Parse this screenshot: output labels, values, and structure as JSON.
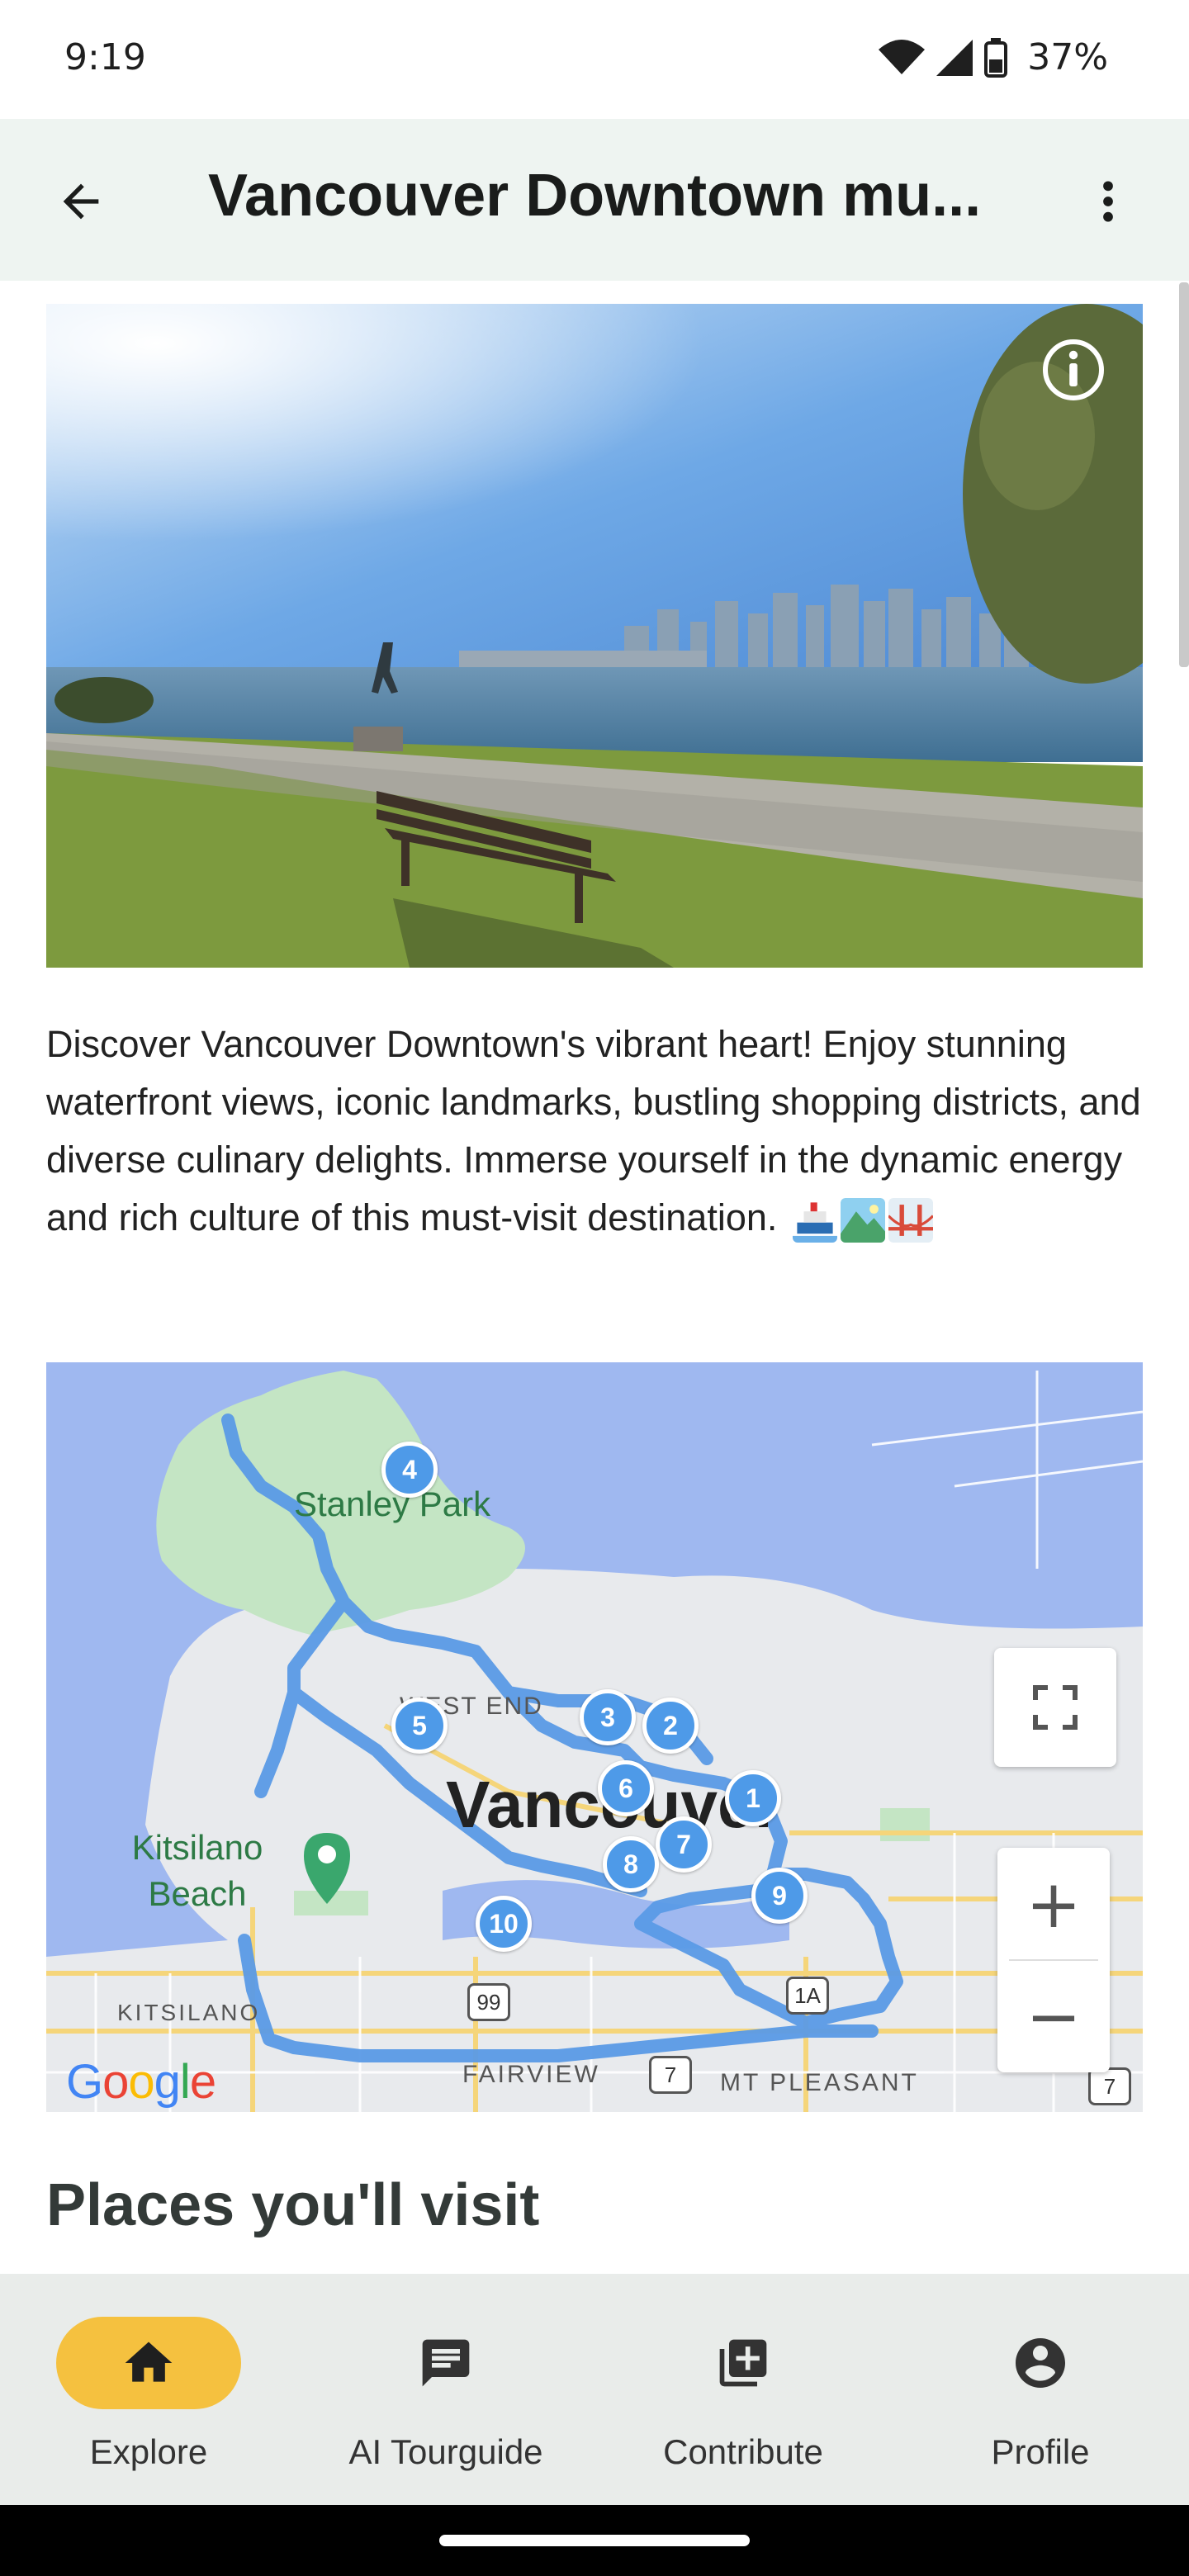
{
  "status_bar": {
    "time": "9:19",
    "battery": "37%"
  },
  "app_bar": {
    "title": "Vancouver Downtown mu..."
  },
  "hero": {
    "info_icon": "info-icon"
  },
  "description": {
    "text": "Discover Vancouver Downtown's vibrant heart! Enjoy stunning waterfront views, iconic landmarks, bustling shopping districts, and diverse culinary delights. Immerse yourself in the dynamic energy and rich culture of this must-visit destination."
  },
  "map": {
    "labels": {
      "stanley_park": "Stanley Park",
      "west_end": "WEST END",
      "vancouver": "Vancouver",
      "kitsilano_beach": "Kitsilano Beach",
      "kitsilano": "KITSILANO",
      "fairview": "FAIRVIEW",
      "mt_pleasant": "MT PLEASANT"
    },
    "road_shields": [
      "99",
      "7",
      "1A",
      "7"
    ],
    "markers": [
      "1",
      "2",
      "3",
      "4",
      "5",
      "6",
      "7",
      "8",
      "9",
      "10"
    ],
    "zoom_in": "+",
    "zoom_out": "−",
    "google_logo": "Google"
  },
  "places_heading": "Places you'll visit",
  "bottom_nav": {
    "items": [
      {
        "label": "Explore",
        "icon": "home-icon",
        "active": true
      },
      {
        "label": "AI Tourguide",
        "icon": "chat-icon",
        "active": false
      },
      {
        "label": "Contribute",
        "icon": "add-box-icon",
        "active": false
      },
      {
        "label": "Profile",
        "icon": "account-icon",
        "active": false
      }
    ]
  },
  "colors": {
    "accent": "#f5c13f",
    "route": "#5a9ae6",
    "app_bar_bg": "#eef4f1"
  }
}
